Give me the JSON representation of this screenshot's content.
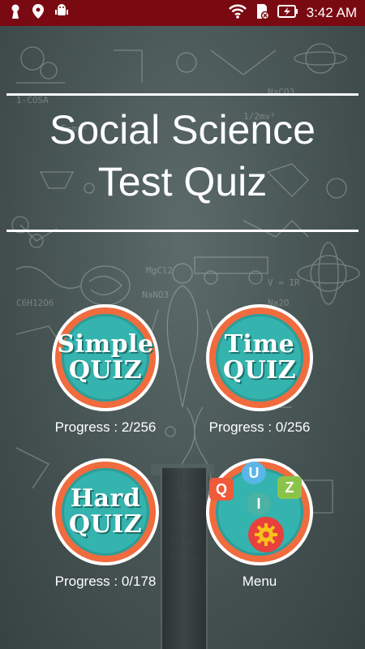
{
  "status_bar": {
    "time": "3:42 AM",
    "left_icons": [
      "keyhole-icon",
      "location-pin-icon",
      "android-debug-icon"
    ],
    "right_icons": [
      "wifi-icon",
      "sd-card-icon",
      "battery-charging-icon"
    ]
  },
  "title": {
    "line1": "Social Science",
    "line2": "Test Quiz"
  },
  "buttons": {
    "simple": {
      "line1": "Simple",
      "line2": "QUIZ",
      "progress": "Progress : 2/256"
    },
    "time": {
      "line1": "Time",
      "line2": "QUIZ",
      "progress": "Progress : 0/256"
    },
    "hard": {
      "line1": "Hard",
      "line2": "QUIZ",
      "progress": "Progress : 0/178"
    },
    "menu": {
      "label": "Menu",
      "tiles": [
        "Q",
        "U",
        "I",
        "Z"
      ]
    }
  },
  "colors": {
    "status_bar": "#7a0a12",
    "badge_ring": "#f06b3d",
    "badge_fill": "#35b3ae",
    "tile_q": "#ef5a3a",
    "tile_u": "#5ab6e6",
    "tile_z": "#8bc34a",
    "tile_i": "#4ab3a3",
    "gear_bg": "#e8413b",
    "gear_fg": "#f6c21c"
  }
}
